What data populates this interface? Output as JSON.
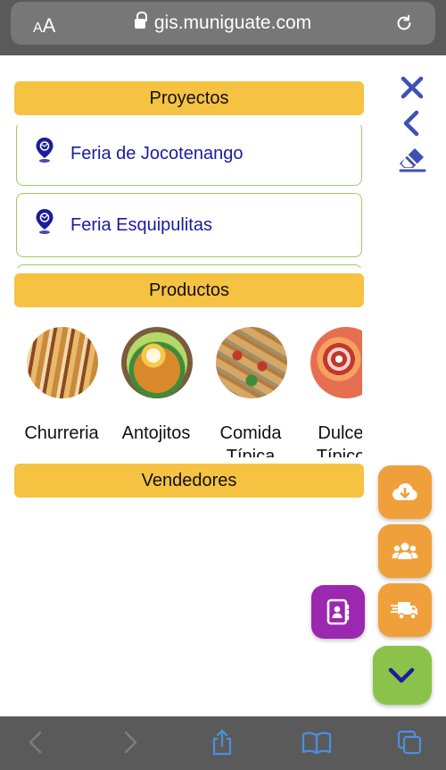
{
  "browser": {
    "text_size_label": "AA",
    "url": "gis.muniguate.com"
  },
  "sections": {
    "proyectos": "Proyectos",
    "productos": "Productos",
    "vendedores": "Vendedores"
  },
  "projects": [
    {
      "name": "Feria de Jocotenango"
    },
    {
      "name": "Feria Esquipulitas"
    }
  ],
  "products": [
    {
      "label": "Churreria"
    },
    {
      "label": "Antojitos"
    },
    {
      "label": "Comida Típica"
    },
    {
      "label": "Dulces Típicos"
    }
  ],
  "colors": {
    "header_yellow": "#f5c242",
    "project_text": "#1c1c9c",
    "card_border": "#9ccc65",
    "fab_orange": "#f0a03a",
    "fab_purple": "#9c27b0",
    "fab_green": "#8bc34a",
    "tool_blue": "#3f51b5"
  },
  "icons": [
    "close-icon",
    "back-chevron-icon",
    "eraser-icon",
    "cloud-download-icon",
    "users-icon",
    "truck-icon",
    "contacts-icon",
    "chevron-down-icon"
  ]
}
